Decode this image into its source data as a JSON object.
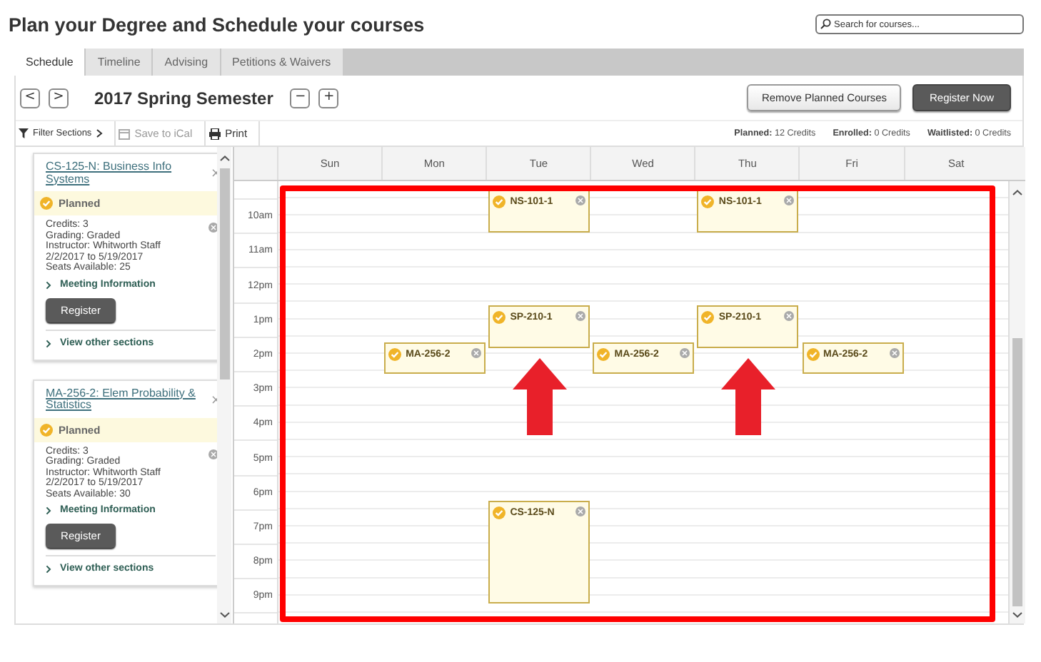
{
  "page": {
    "title": "Plan your Degree and Schedule your courses",
    "search": {
      "placeholder": "Search for courses..."
    }
  },
  "tabs": [
    {
      "label": "Schedule",
      "selected": true
    },
    {
      "label": "Timeline",
      "selected": false
    },
    {
      "label": "Advising",
      "selected": false
    },
    {
      "label": "Petitions & Waivers",
      "selected": false
    }
  ],
  "semester": {
    "prev": "<",
    "next": ">",
    "title": "2017 Spring Semester",
    "collapse": "−",
    "expand": "+"
  },
  "buttons": [
    {
      "label": "Remove Planned Courses",
      "kind": "secondary"
    },
    {
      "label": "Register Now",
      "kind": "primary"
    }
  ],
  "toolbar": [
    {
      "label": "Filter Sections",
      "kind": "filter",
      "disabled": false
    },
    {
      "label": "Save to iCal",
      "kind": "calendar",
      "disabled": true
    },
    {
      "label": "Print",
      "kind": "print",
      "disabled": false
    }
  ],
  "credits": [
    {
      "label": "Planned:",
      "value": "12 Credits"
    },
    {
      "label": "Enrolled:",
      "value": "0 Credits"
    },
    {
      "label": "Waitlisted:",
      "value": "0 Credits"
    }
  ],
  "cards": [
    {
      "title": "CS-125-N: Business Info Systems",
      "close": "×",
      "status": "Planned",
      "details": [
        "Credits: 3",
        "Grading: Graded",
        "Instructor: Whitworth Staff",
        "2/2/2017 to 5/19/2017",
        "Seats Available:  25"
      ],
      "meeting_link": "Meeting Information",
      "button": "Register",
      "other_link": "View other sections"
    },
    {
      "title": "MA-256-2: Elem Probability & Statistics",
      "close": "×",
      "status": "Planned",
      "details": [
        "Credits: 3",
        "Grading: Graded",
        "Instructor: Whitworth Staff",
        "2/2/2017 to 5/19/2017",
        "Seats Available:  30"
      ],
      "meeting_link": "Meeting Information",
      "button": "Register",
      "other_link": "View other sections"
    }
  ],
  "calendar": {
    "hours": [
      "10am",
      "11am",
      "12pm",
      "1pm",
      "2pm",
      "3pm",
      "4pm",
      "5pm",
      "6pm",
      "7pm",
      "8pm",
      "9pm"
    ],
    "days": [
      {
        "label": "Sun",
        "arrow": false
      },
      {
        "label": "Mon",
        "arrow": false,
        "events": [
          {
            "code": "MA-256-2"
          }
        ]
      },
      {
        "label": "Tue",
        "arrow": true,
        "events": [
          {
            "code": "NS-101-1"
          },
          {
            "code": "SP-210-1"
          },
          {
            "code": "CS-125-N"
          }
        ]
      },
      {
        "label": "Wed",
        "arrow": false,
        "events": [
          {
            "code": "MA-256-2"
          }
        ]
      },
      {
        "label": "Thu",
        "arrow": true,
        "events": [
          {
            "code": "NS-101-1"
          },
          {
            "code": "SP-210-1"
          }
        ]
      },
      {
        "label": "Fri",
        "arrow": false,
        "events": [
          {
            "code": "MA-256-2"
          }
        ]
      },
      {
        "label": "Sat",
        "arrow": false
      }
    ]
  },
  "annotation": {
    "frame": true
  }
}
